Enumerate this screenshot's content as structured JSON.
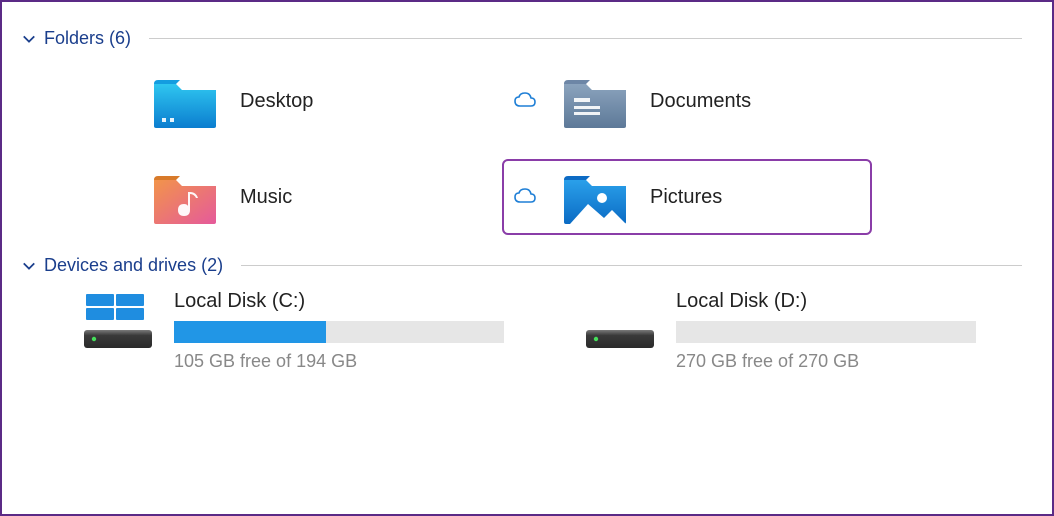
{
  "sections": {
    "folders": {
      "title": "Folders",
      "count": "(6)",
      "items": [
        {
          "label": "Desktop",
          "cloud": false,
          "icon": "desktop",
          "highlight": false
        },
        {
          "label": "Documents",
          "cloud": true,
          "icon": "documents",
          "highlight": false
        },
        {
          "label": "Music",
          "cloud": false,
          "icon": "music",
          "highlight": false
        },
        {
          "label": "Pictures",
          "cloud": true,
          "icon": "pictures",
          "highlight": true
        }
      ]
    },
    "drives": {
      "title": "Devices and drives",
      "count": "(2)",
      "items": [
        {
          "name": "Local Disk (C:)",
          "free_text": "105 GB free of 194 GB",
          "used_pct": 46,
          "os_icon": true
        },
        {
          "name": "Local Disk (D:)",
          "free_text": "270 GB free of 270 GB",
          "used_pct": 0,
          "os_icon": false
        }
      ]
    }
  }
}
